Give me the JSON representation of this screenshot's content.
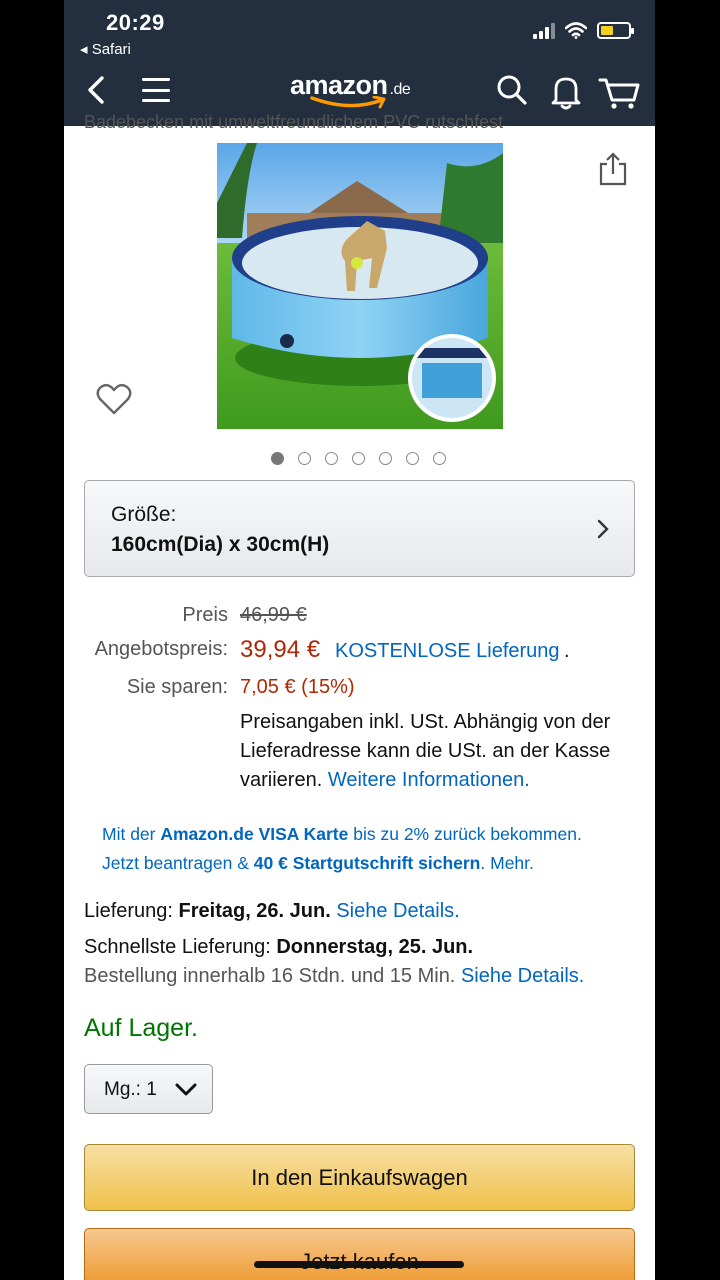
{
  "status": {
    "time": "20:29",
    "back_app": "◂ Safari",
    "battery_fraction": 0.45
  },
  "header": {
    "logo": "amazon",
    "logo_tld": ".de"
  },
  "product": {
    "title_partial": "Badebecken mit umweltfreundlichem PVC rutschfest"
  },
  "gallery": {
    "image_count": 7,
    "active_index": 0
  },
  "size": {
    "label": "Größe:",
    "value": "160cm(Dia) x 30cm(H)"
  },
  "pricing": {
    "list_label": "Preis",
    "list_price": "46,99 €",
    "sale_label": "Angebotspreis:",
    "sale_price": "39,94 €",
    "free_delivery": "KOSTENLOSE Lieferung",
    "free_delivery_suffix": ".",
    "savings_label": "Sie sparen:",
    "savings": "7,05 € (15%)",
    "tax_note": "Preisangaben inkl. USt. Abhängig von der Lieferadresse kann die USt. an der Kasse variieren. ",
    "tax_link": "Weitere Informationen."
  },
  "visa": {
    "line1_a": "Mit der ",
    "line1_b": "Amazon.de VISA Karte",
    "line1_c": " bis zu 2% zurück bekommen.",
    "line2_a": "Jetzt beantragen & ",
    "line2_b": "40 € Startgutschrift sichern",
    "line2_c": ". Mehr."
  },
  "delivery": {
    "label": "Lieferung: ",
    "date": "Freitag, 26. Jun.",
    "details": " Siehe Details.",
    "fast_label": "Schnellste Lieferung: ",
    "fast_date": "Donnerstag, 25. Jun.",
    "order_within": "Bestellung innerhalb 16 Stdn. und 15 Min. ",
    "order_details": "Siehe Details."
  },
  "stock": "Auf Lager.",
  "quantity": {
    "label": "Mg.: ",
    "value": "1"
  },
  "buttons": {
    "add_to_cart": "In den Einkaufswagen",
    "buy_now": "Jetzt kaufen"
  },
  "colors": {
    "nav_bg": "#232f3e",
    "price_red": "#b12704",
    "link_blue": "#0066c0",
    "stock_green": "#007600",
    "cart_button": "#f0c14b",
    "buy_button": "#ed9220"
  }
}
